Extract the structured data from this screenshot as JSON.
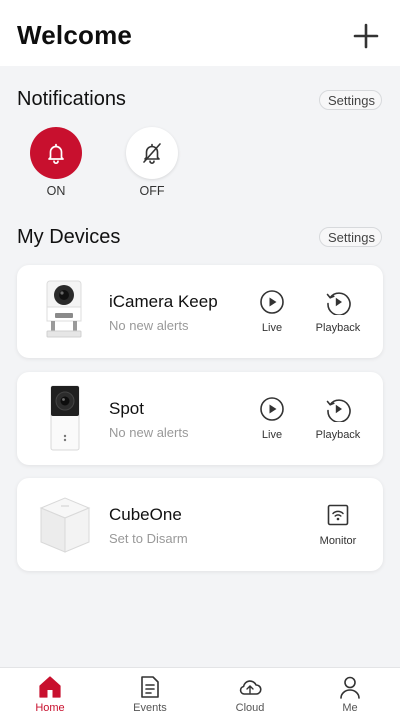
{
  "header": {
    "title": "Welcome",
    "add_icon": "plus-icon"
  },
  "notifications": {
    "title": "Notifications",
    "settings_label": "Settings",
    "on_label": "ON",
    "off_label": "OFF",
    "on_icon": "bell-icon",
    "off_icon": "bell-slash-icon",
    "on_color": "#c8102e"
  },
  "devices": {
    "title": "My Devices",
    "settings_label": "Settings",
    "items": [
      {
        "name": "iCamera Keep",
        "status": "No new alerts",
        "actions": [
          {
            "label": "Live",
            "icon": "play-circle-icon"
          },
          {
            "label": "Playback",
            "icon": "playback-icon"
          }
        ]
      },
      {
        "name": "Spot",
        "status": "No new alerts",
        "actions": [
          {
            "label": "Live",
            "icon": "play-circle-icon"
          },
          {
            "label": "Playback",
            "icon": "playback-icon"
          }
        ]
      },
      {
        "name": "CubeOne",
        "status": "Set to Disarm",
        "actions": [
          {
            "label": "Monitor",
            "icon": "monitor-wifi-icon"
          }
        ]
      }
    ]
  },
  "tabbar": {
    "active_color": "#c8102e",
    "tabs": [
      {
        "label": "Home",
        "icon": "home-icon",
        "active": true
      },
      {
        "label": "Events",
        "icon": "document-icon",
        "active": false
      },
      {
        "label": "Cloud",
        "icon": "cloud-icon",
        "active": false
      },
      {
        "label": "Me",
        "icon": "person-icon",
        "active": false
      }
    ]
  }
}
